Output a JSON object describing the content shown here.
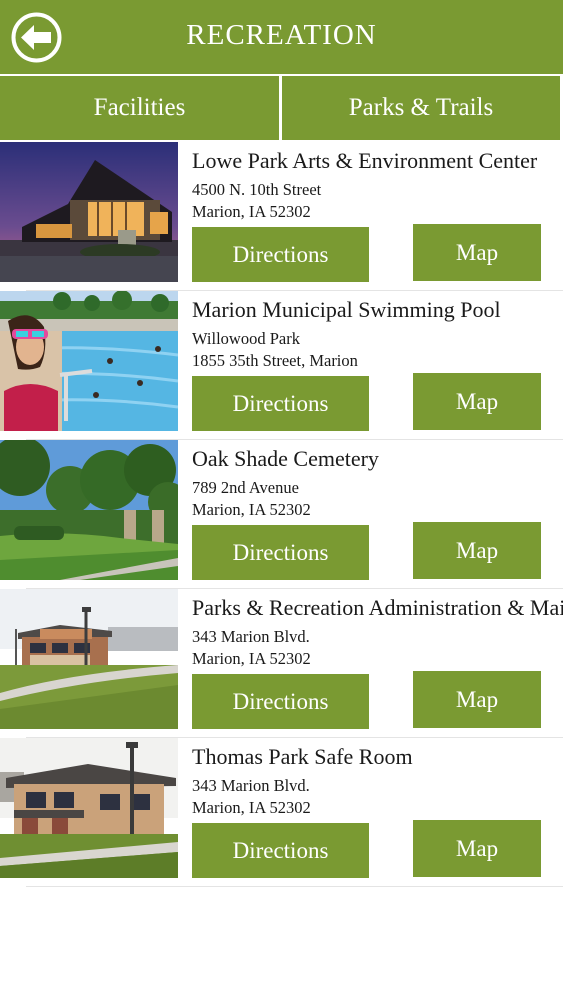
{
  "header": {
    "title": "RECREATION",
    "back_icon": "back-arrow-icon",
    "accent_color": "#7a9a32"
  },
  "tabs": [
    {
      "label": "Facilities"
    },
    {
      "label": "Parks & Trails"
    }
  ],
  "facilities": [
    {
      "name": "Lowe Park Arts & Environment Center",
      "address_line1": "4500 N. 10th Street",
      "address_line2": "Marion, IA 52302",
      "directions_label": "Directions",
      "map_label": "Map",
      "image": "lowe-park-building-photo"
    },
    {
      "name": "Marion Municipal Swimming Pool",
      "address_line1": "Willowood Park",
      "address_line2": "1855 35th Street, Marion",
      "directions_label": "Directions",
      "map_label": "Map",
      "image": "swimming-pool-photo"
    },
    {
      "name": "Oak Shade Cemetery",
      "address_line1": "789 2nd Avenue",
      "address_line2": "Marion, IA 52302",
      "directions_label": "Directions",
      "map_label": "Map",
      "image": "cemetery-photo"
    },
    {
      "name": "Parks & Recreation Administration & Maintenance",
      "address_line1": "343 Marion Blvd.",
      "address_line2": "Marion, IA 52302",
      "directions_label": "Directions",
      "map_label": "Map",
      "image": "administration-building-photo"
    },
    {
      "name": "Thomas Park Safe Room",
      "address_line1": "343 Marion Blvd.",
      "address_line2": "Marion, IA 52302",
      "directions_label": "Directions",
      "map_label": "Map",
      "image": "safe-room-building-photo"
    }
  ]
}
